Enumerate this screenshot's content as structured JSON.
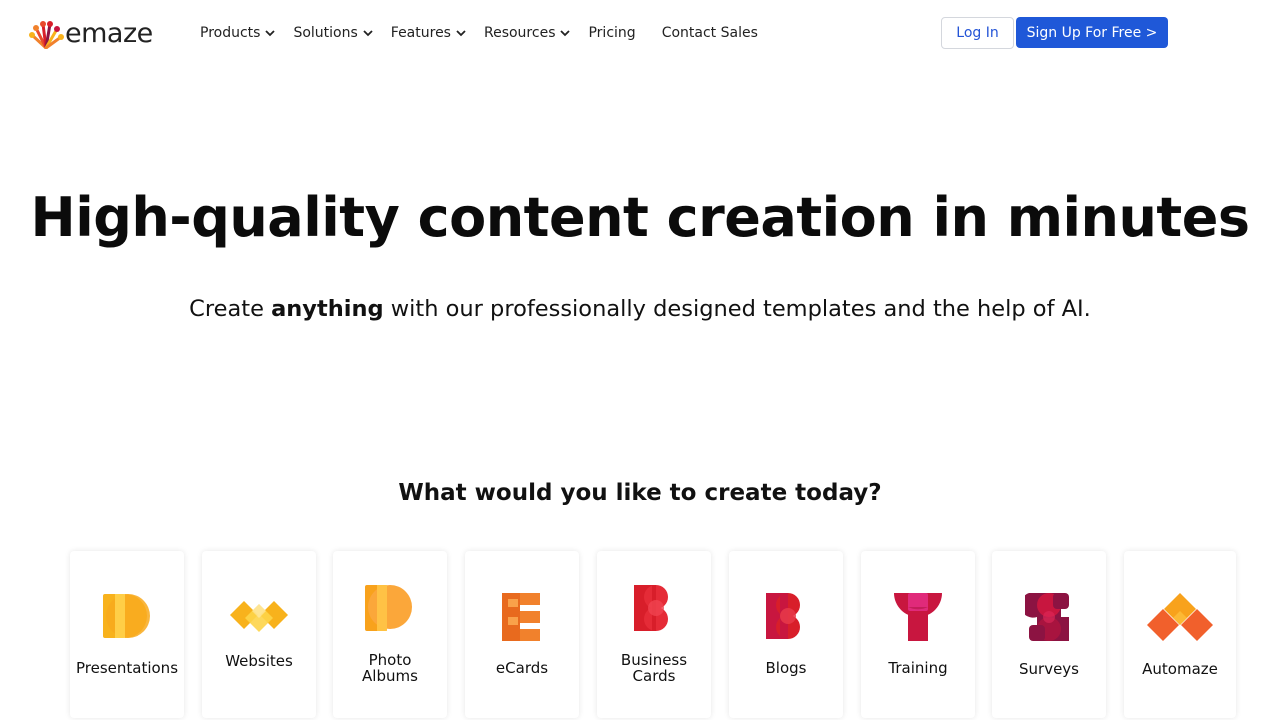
{
  "brand": {
    "name": "emaze"
  },
  "nav": {
    "products": "Products",
    "solutions": "Solutions",
    "features": "Features",
    "resources": "Resources",
    "pricing": "Pricing",
    "contact": "Contact Sales"
  },
  "auth": {
    "login": "Log In",
    "signup": "Sign Up For Free >"
  },
  "hero": {
    "title": "High-quality content creation in minutes",
    "sub_pre": "Create ",
    "sub_bold": "anything",
    "sub_post": " with our professionally designed templates and the help of AI."
  },
  "create": {
    "heading": "What would you like to create today?",
    "cards": [
      {
        "label": "Presentations",
        "icon": "presentations-icon"
      },
      {
        "label": "Websites",
        "icon": "websites-icon"
      },
      {
        "label": "Photo Albums",
        "line1": "Photo",
        "line2": "Albums",
        "icon": "photo-albums-icon"
      },
      {
        "label": "eCards",
        "icon": "ecards-icon"
      },
      {
        "label": "Business Cards",
        "line1": "Business",
        "line2": "Cards",
        "icon": "business-cards-icon"
      },
      {
        "label": "Blogs",
        "icon": "blogs-icon"
      },
      {
        "label": "Training",
        "icon": "training-icon"
      },
      {
        "label": "Surveys",
        "icon": "surveys-icon"
      },
      {
        "label": "Automaze",
        "icon": "automaze-icon"
      }
    ]
  },
  "colors": {
    "accent": "#1f58d8",
    "yellow": "#f8b21c",
    "orange": "#f1812c",
    "red": "#d81e2a",
    "crimson": "#c8163f",
    "maroon": "#8c1342"
  }
}
